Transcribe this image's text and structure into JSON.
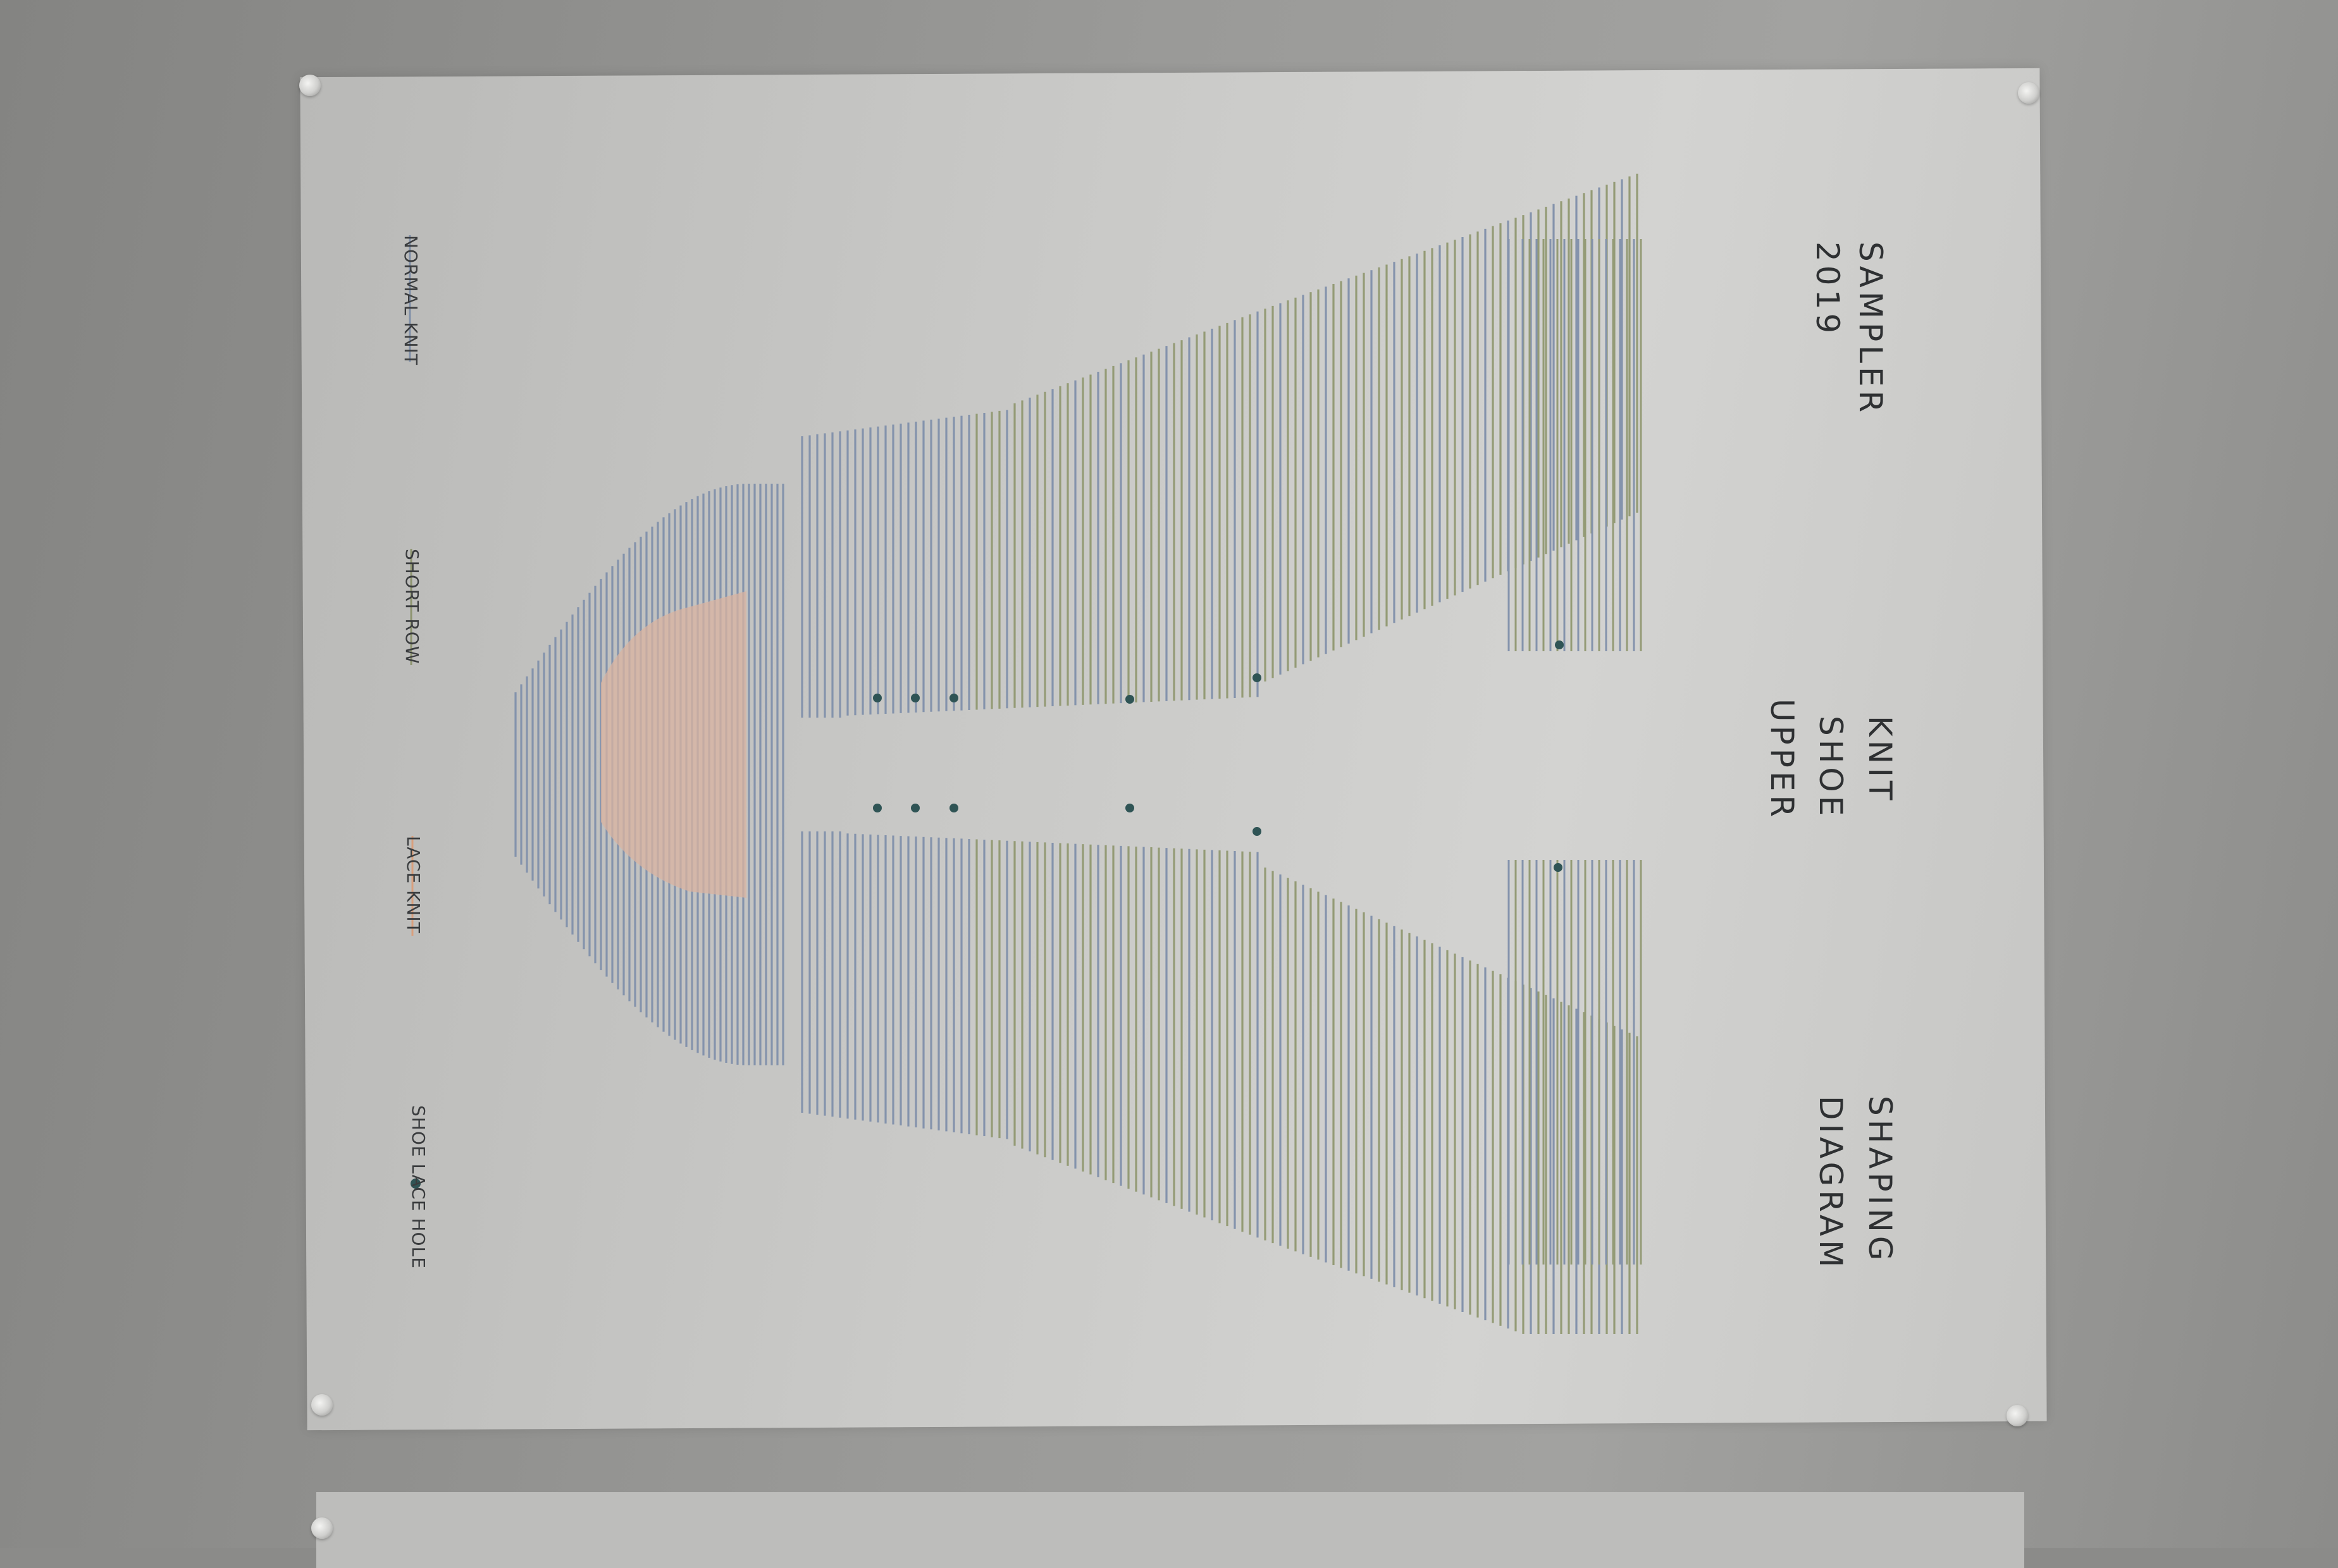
{
  "poster": {
    "header_left": [
      "SAMPLER",
      "2019"
    ],
    "header_center": [
      "KNIT",
      "SHOE",
      "UPPER"
    ],
    "header_right": [
      "SHAPING",
      "DIAGRAM"
    ]
  },
  "legend": [
    {
      "label": "NORMAL KNIT",
      "color": "#7f8fa8"
    },
    {
      "label": "SHORT ROW",
      "color": "#8e9570"
    },
    {
      "label": "LACE KNIT",
      "color": "#d8a07e"
    },
    {
      "label": "SHOE LACE HOLE",
      "color": "#2f5455"
    }
  ],
  "colors": {
    "normal_knit": "#8493ac",
    "short_row": "#949b76",
    "lace_fill": "#d9b3a0",
    "lace_hole": "#2f5455"
  }
}
